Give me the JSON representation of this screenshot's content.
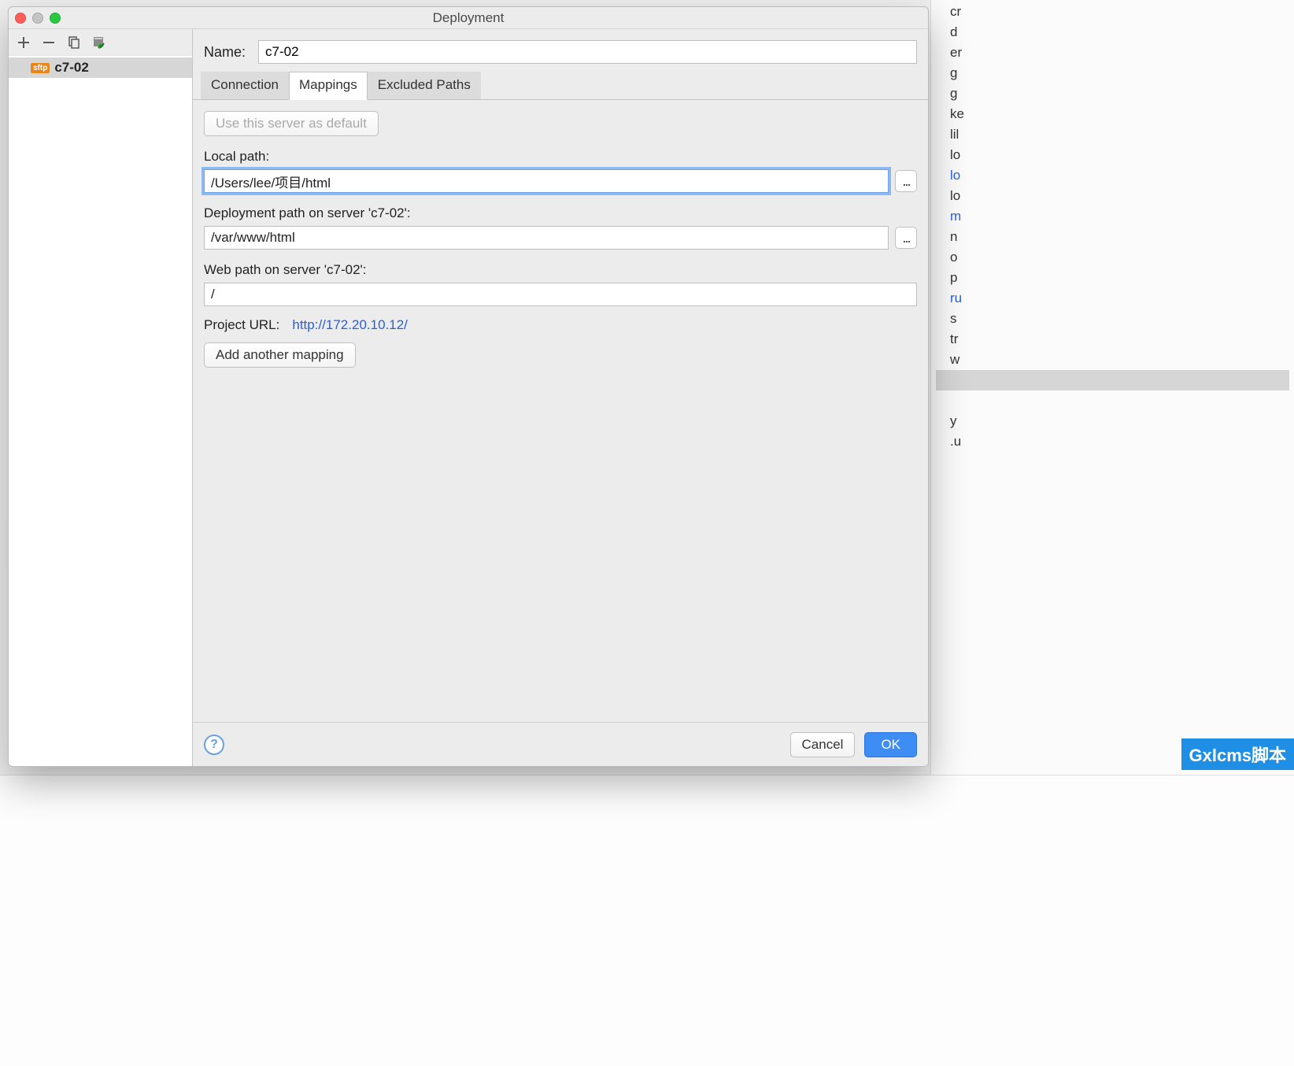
{
  "window": {
    "title": "Deployment"
  },
  "sidebar": {
    "toolbar": {
      "add_tip": "Add",
      "remove_tip": "Remove",
      "copy_tip": "Copy",
      "check_tip": "Set as Default"
    },
    "items": [
      {
        "type_badge": "sftp",
        "label": "c7-02"
      }
    ]
  },
  "main": {
    "name_label": "Name:",
    "name_value": "c7-02",
    "tabs": [
      {
        "label": "Connection"
      },
      {
        "label": "Mappings"
      },
      {
        "label": "Excluded Paths"
      }
    ],
    "active_tab": 1,
    "default_button": "Use this server as default",
    "local_path_label": "Local path:",
    "local_path_value": "/Users/lee/项目/html",
    "deployment_path_label": "Deployment path on server 'c7-02':",
    "deployment_path_value": "/var/www/html",
    "web_path_label": "Web path on server 'c7-02':",
    "web_path_value": "/",
    "project_url_label": "Project URL:",
    "project_url_value": "http://172.20.10.12/",
    "add_mapping_label": "Add another mapping",
    "browse_glyph": "..."
  },
  "footer": {
    "help_glyph": "?",
    "cancel_label": "Cancel",
    "ok_label": "OK"
  },
  "background_items": [
    {
      "t": "cr",
      "c": ""
    },
    {
      "t": "d",
      "c": ""
    },
    {
      "t": "er",
      "c": ""
    },
    {
      "t": "g",
      "c": ""
    },
    {
      "t": "g",
      "c": ""
    },
    {
      "t": "ke",
      "c": ""
    },
    {
      "t": "lil",
      "c": ""
    },
    {
      "t": "lo",
      "c": ""
    },
    {
      "t": "lo",
      "c": "blue"
    },
    {
      "t": "lo",
      "c": ""
    },
    {
      "t": "m",
      "c": "blue"
    },
    {
      "t": "n",
      "c": ""
    },
    {
      "t": "o",
      "c": ""
    },
    {
      "t": "p",
      "c": ""
    },
    {
      "t": "ru",
      "c": "blue"
    },
    {
      "t": "s",
      "c": ""
    },
    {
      "t": "tr",
      "c": ""
    },
    {
      "t": "w",
      "c": ""
    },
    {
      "t": "",
      "c": "selected"
    },
    {
      "t": "",
      "c": ""
    },
    {
      "t": "y",
      "c": ""
    },
    {
      "t": ".u",
      "c": ""
    }
  ],
  "watermark": "Gxlcms脚本"
}
